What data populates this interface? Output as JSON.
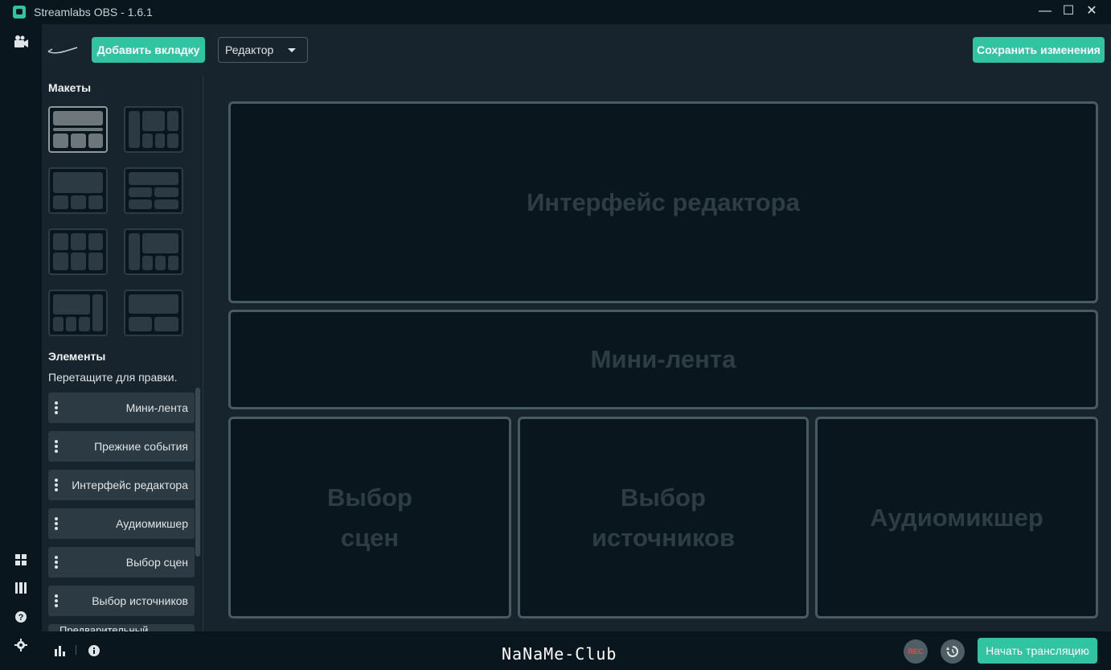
{
  "window": {
    "title": "Streamlabs OBS - 1.6.1",
    "minimize": "—",
    "maximize": "☐",
    "close": "✕"
  },
  "leftnav": {
    "top_icon": "camera-icon",
    "bottom_icons": [
      "layout-grid-icon",
      "columns-icon",
      "help-icon",
      "settings-icon"
    ]
  },
  "toolbar": {
    "add_tab_label": "Добавить вкладку",
    "mode_dropdown": "Редактор",
    "save_label": "Сохранить изменения"
  },
  "sidebar": {
    "layouts_title": "Макеты",
    "elements_title": "Элементы",
    "elements_hint": "Перетащите для правки.",
    "elements": [
      "Мини-лента",
      "Прежние события",
      "Интерфейс редактора",
      "Аудиомикшер",
      "Выбор сцен",
      "Выбор источников",
      "Предварительный"
    ]
  },
  "main": {
    "panels": {
      "editor": "Интерфейс редактора",
      "minifeed": "Мини-лента",
      "scenes_line1": "Выбор",
      "scenes_line2": "сцен",
      "sources_line1": "Выбор",
      "sources_line2": "источников",
      "mixer": "Аудиомикшер"
    }
  },
  "footer": {
    "watermark": "NaNaMe-Club",
    "rec_label": "REC",
    "go_live_label": "Начать трансляцию"
  },
  "colors": {
    "accent": "#31c3a2",
    "background": "#17242d",
    "dark": "#09161d",
    "rec": "#e44b4b"
  }
}
